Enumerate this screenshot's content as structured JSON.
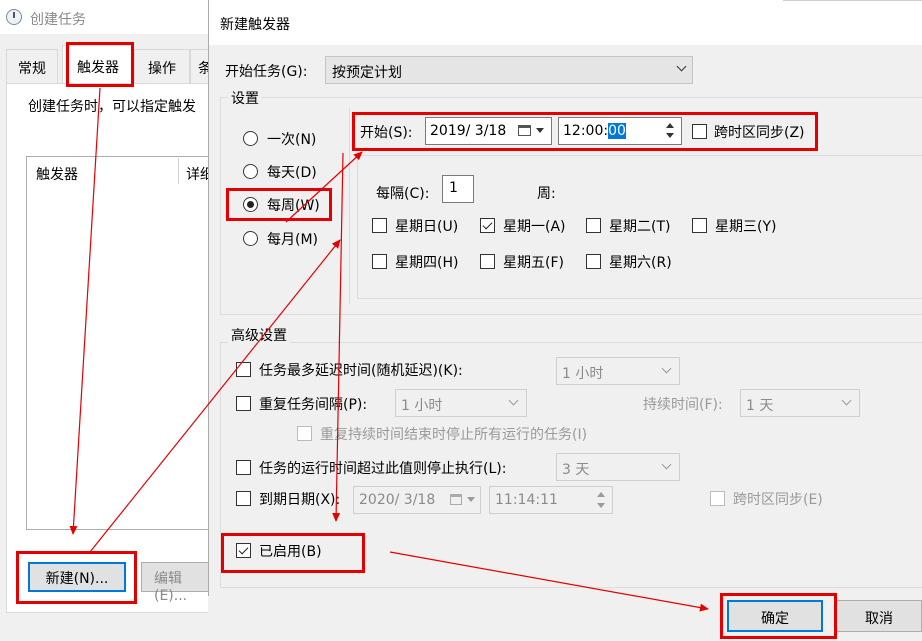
{
  "bg_window": {
    "title": "创建任务",
    "tabs": [
      "常规",
      "触发器",
      "操作",
      "条"
    ],
    "description": "创建任务时，可以指定触发",
    "columns": [
      "触发器",
      "详细"
    ],
    "new_button": "新建(N)...",
    "edit_button": "编辑(E)..."
  },
  "dialog": {
    "title": "新建触发器",
    "begin_label": "开始任务(G):",
    "begin_value": "按预定计划",
    "settings_title": "设置",
    "schedule_options": [
      "一次(N)",
      "每天(D)",
      "每周(W)",
      "每月(M)"
    ],
    "schedule_selected": "每周(W)",
    "start_label": "开始(S):",
    "start_date": "2019/  3/18",
    "start_time_prefix": "12:00:",
    "start_time_selected": "00",
    "sync_tz_label": "跨时区同步(Z)",
    "sync_tz_checked": false,
    "recur_label": "每隔(C):",
    "recur_value": "1",
    "weeks_label": "周:",
    "weekdays": [
      {
        "label": "星期日(U)",
        "checked": false
      },
      {
        "label": "星期一(A)",
        "checked": true
      },
      {
        "label": "星期二(T)",
        "checked": false
      },
      {
        "label": "星期三(Y)",
        "checked": false
      },
      {
        "label": "星期四(H)",
        "checked": false
      },
      {
        "label": "星期五(F)",
        "checked": false
      },
      {
        "label": "星期六(R)",
        "checked": false
      }
    ],
    "advanced": {
      "title": "高级设置",
      "delay_label": "任务最多延迟时间(随机延迟)(K):",
      "delay_value": "1 小时",
      "repeat_label": "重复任务间隔(P):",
      "repeat_value": "1 小时",
      "duration_label": "持续时间(F):",
      "duration_value": "1 天",
      "stop_repeat_label": "重复持续时间结束时停止所有运行的任务(I)",
      "stop_long_label": "任务的运行时间超过此值则停止执行(L):",
      "stop_long_value": "3 天",
      "expire_label": "到期日期(X):",
      "expire_date": "2020/  3/18",
      "expire_time": "11:14:11",
      "expire_sync_label": "跨时区同步(E)",
      "enabled_label": "已启用(B)",
      "enabled_checked": true
    },
    "ok_button": "确定",
    "cancel_button": "取消"
  },
  "colors": {
    "annotation_red": "#e50000",
    "focus_blue": "#0078d7",
    "window_bg": "#f0f0f0"
  }
}
